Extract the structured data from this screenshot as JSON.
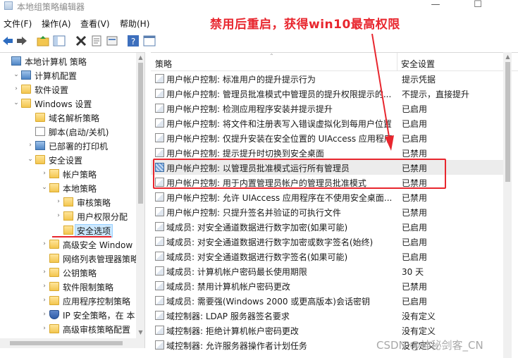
{
  "window": {
    "title": "本地组策略编辑器",
    "controls": {
      "minimize": "—",
      "maximize": "☐"
    }
  },
  "menubar": {
    "items": [
      "文件(F)",
      "操作(A)",
      "查看(V)",
      "帮助(H)"
    ]
  },
  "toolbar": {
    "icons": [
      "back-arrow-icon",
      "forward-arrow-icon",
      "folder-up-icon",
      "show-tree-icon",
      "delete-icon",
      "properties-icon",
      "export-icon",
      "help-icon",
      "console-icon"
    ]
  },
  "annotation": {
    "text": "禁用后重启，获得win10最高权限",
    "color": "#e8262e"
  },
  "tree": {
    "items": [
      {
        "label": "本地计算机 策略",
        "icon": "computer-policy-icon",
        "expand": ""
      },
      {
        "label": "计算机配置",
        "icon": "computer-icon",
        "expand": "⌄"
      },
      {
        "label": "软件设置",
        "icon": "folder-icon",
        "expand": "›"
      },
      {
        "label": "Windows 设置",
        "icon": "folder-icon",
        "expand": "⌄"
      },
      {
        "label": "域名解析策略",
        "icon": "folder-icon",
        "expand": ""
      },
      {
        "label": "脚本(启动/关机)",
        "icon": "script-icon",
        "expand": ""
      },
      {
        "label": "已部署的打印机",
        "icon": "printer-icon",
        "expand": "›"
      },
      {
        "label": "安全设置",
        "icon": "security-folder-icon",
        "expand": "⌄"
      },
      {
        "label": "帐户策略",
        "icon": "folder-lock-icon",
        "expand": "›"
      },
      {
        "label": "本地策略",
        "icon": "folder-lock-icon",
        "expand": "⌄"
      },
      {
        "label": "审核策略",
        "icon": "folder-lock-icon",
        "expand": "›"
      },
      {
        "label": "用户权限分配",
        "icon": "folder-lock-icon",
        "expand": "›"
      },
      {
        "label": "安全选项",
        "icon": "folder-lock-icon",
        "expand": "",
        "selected": true
      },
      {
        "label": "高级安全 Window",
        "icon": "folder-icon",
        "expand": "›"
      },
      {
        "label": "网络列表管理器策略",
        "icon": "folder-icon",
        "expand": ""
      },
      {
        "label": "公钥策略",
        "icon": "folder-icon",
        "expand": "›"
      },
      {
        "label": "软件限制策略",
        "icon": "folder-icon",
        "expand": "›"
      },
      {
        "label": "应用程序控制策略",
        "icon": "folder-icon",
        "expand": "›"
      },
      {
        "label": "IP 安全策略，在 本",
        "icon": "ip-security-icon",
        "expand": "›"
      },
      {
        "label": "高级审核策略配置",
        "icon": "folder-icon",
        "expand": "›"
      }
    ]
  },
  "list": {
    "columns": {
      "policy": "策略",
      "setting": "安全设置"
    },
    "rows": [
      {
        "policy": "用户帐户控制: 标准用户的提升提示行为",
        "setting": "提示凭据"
      },
      {
        "policy": "用户帐户控制: 管理员批准模式中管理员的提升权限提示的...",
        "setting": "不提示，直接提升"
      },
      {
        "policy": "用户帐户控制: 检测应用程序安装并提示提升",
        "setting": "已启用"
      },
      {
        "policy": "用户帐户控制: 将文件和注册表写入错误虚拟化到每用户位置",
        "setting": "已启用"
      },
      {
        "policy": "用户帐户控制: 仅提升安装在安全位置的 UIAccess 应用程序",
        "setting": "已启用"
      },
      {
        "policy": "用户帐户控制: 提示提升时切换到安全桌面",
        "setting": "已禁用"
      },
      {
        "policy": "用户帐户控制: 以管理员批准模式运行所有管理员",
        "setting": "已禁用",
        "highlight": true,
        "boxed": true
      },
      {
        "policy": "用户帐户控制: 用于内置管理员帐户的管理员批准模式",
        "setting": "已禁用",
        "boxed": true
      },
      {
        "policy": "用户帐户控制: 允许 UIAccess 应用程序在不使用安全桌面...",
        "setting": "已禁用"
      },
      {
        "policy": "用户帐户控制: 只提升签名并验证的可执行文件",
        "setting": "已禁用"
      },
      {
        "policy": "域成员: 对安全通道数据进行数字加密(如果可能)",
        "setting": "已启用"
      },
      {
        "policy": "域成员: 对安全通道数据进行数字加密或数字签名(始终)",
        "setting": "已启用"
      },
      {
        "policy": "域成员: 对安全通道数据进行数字签名(如果可能)",
        "setting": "已启用"
      },
      {
        "policy": "域成员: 计算机帐户密码最长使用期限",
        "setting": "30 天"
      },
      {
        "policy": "域成员: 禁用计算机帐户密码更改",
        "setting": "已禁用"
      },
      {
        "policy": "域成员: 需要强(Windows 2000 或更高版本)会话密钥",
        "setting": "已启用"
      },
      {
        "policy": "域控制器: LDAP 服务器签名要求",
        "setting": "没有定义"
      },
      {
        "policy": "域控制器: 拒绝计算机帐户密码更改",
        "setting": "没有定义"
      },
      {
        "policy": "域控制器: 允许服务器操作者计划任务",
        "setting": "没有定义"
      }
    ]
  },
  "watermark": "CSDN @神秘剑客_CN"
}
